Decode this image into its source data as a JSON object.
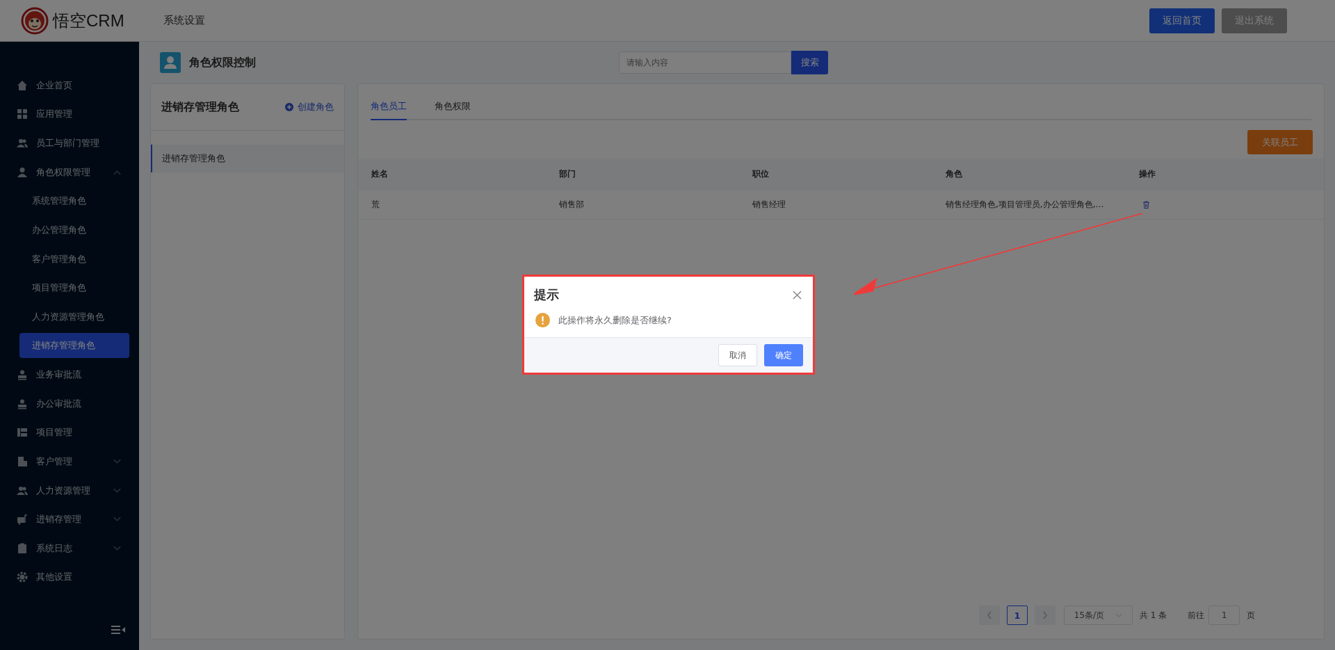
{
  "header": {
    "logo": "悟空CRM",
    "nav": "系统设置",
    "buttons": [
      {
        "label": "返回首页",
        "kind": "primary"
      },
      {
        "label": "退出系统",
        "kind": "secondary"
      }
    ]
  },
  "sidebar": {
    "items": [
      {
        "label": "企业首页"
      },
      {
        "label": "应用管理"
      },
      {
        "label": "员工与部门管理"
      },
      {
        "label": "角色权限管理",
        "expanded": true,
        "children": [
          {
            "label": "系统管理角色",
            "selected": false
          },
          {
            "label": "办公管理角色",
            "selected": false
          },
          {
            "label": "客户管理角色",
            "selected": false
          },
          {
            "label": "项目管理角色",
            "selected": false
          },
          {
            "label": "人力资源管理角色",
            "selected": false
          },
          {
            "label": "进销存管理角色",
            "selected": true
          }
        ]
      },
      {
        "label": "业务审批流"
      },
      {
        "label": "办公审批流"
      },
      {
        "label": "项目管理"
      },
      {
        "label": "客户管理",
        "expanded": false
      },
      {
        "label": "人力资源管理",
        "expanded": false
      },
      {
        "label": "进销存管理",
        "expanded": false
      },
      {
        "label": "系统日志",
        "expanded": false
      },
      {
        "label": "其他设置"
      }
    ]
  },
  "page": {
    "title": "角色权限控制",
    "search": {
      "placeholder": "请输入内容",
      "button": "搜索"
    }
  },
  "role_panel": {
    "title": "进销存管理角色",
    "action": "创建角色",
    "roles": [
      {
        "label": "进销存管理角色",
        "selected": true
      }
    ]
  },
  "tabs": [
    {
      "label": "角色员工",
      "selected": true
    },
    {
      "label": "角色权限",
      "selected": false
    }
  ],
  "action_button": "关联员工",
  "table": {
    "columns": [
      "姓名",
      "部门",
      "职位",
      "角色",
      "操作"
    ],
    "rows": [
      {
        "cells": [
          "荒",
          "销售部",
          "销售经理",
          "销售经理角色,项目管理员,办公管理角色,…"
        ]
      }
    ]
  },
  "pagination": {
    "current": "1",
    "page_size": "15条/页",
    "total": "共 1 条",
    "goto_label": "前往",
    "goto_value": "1",
    "goto_suffix": "页"
  },
  "dialog": {
    "title": "提示",
    "message": "此操作将永久删除是否继续?",
    "buttons": [
      {
        "label": "取消",
        "kind": "secondary"
      },
      {
        "label": "确定",
        "kind": "primary"
      }
    ]
  }
}
